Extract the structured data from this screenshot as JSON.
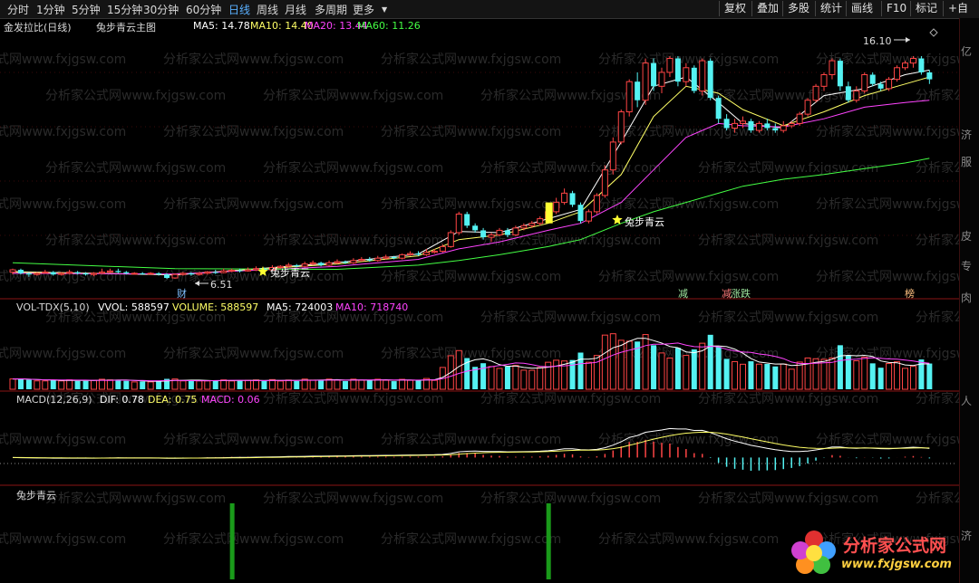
{
  "toolbar": {
    "tabs": [
      {
        "label": "分时",
        "active": false
      },
      {
        "label": "1分钟",
        "active": false
      },
      {
        "label": "5分钟",
        "active": false
      },
      {
        "label": "15分钟",
        "active": false
      },
      {
        "label": "30分钟",
        "active": false
      },
      {
        "label": "60分钟",
        "active": false
      },
      {
        "label": "日线",
        "active": true
      },
      {
        "label": "周线",
        "active": false
      },
      {
        "label": "月线",
        "active": false
      },
      {
        "label": "多周期",
        "active": false
      },
      {
        "label": "更多",
        "active": false
      }
    ],
    "more_arrow": "▼",
    "right_buttons": [
      "复权",
      "叠加",
      "多股",
      "统计",
      "画线",
      "F10",
      "标记",
      "+自"
    ]
  },
  "main_panel": {
    "title": "金发拉比(日线)",
    "indicator_name": "兔步青云主图",
    "ma5": "MA5: 14.78",
    "ma10": "MA10: 14.40",
    "ma20": "MA20: 13.44",
    "ma60": "MA60: 11.26",
    "high_label": "16.10",
    "low_label": "6.51",
    "signals": [
      "兔步青云",
      "兔步青云"
    ],
    "markers": [
      "财",
      "减",
      "减",
      "涨跌",
      "榜"
    ]
  },
  "vol_panel": {
    "title": "VOL-TDX(5,10)",
    "vvol": "VVOL: 588597",
    "volume": "VOLUME: 588597",
    "ma5": "MA5: 724003",
    "ma10": "MA10: 718740"
  },
  "macd_panel": {
    "title": "MACD(12,26,9)",
    "dif": "DIF: 0.78",
    "dea": "DEA: 0.75",
    "macd": "MACD: 0.06"
  },
  "signal_panel": {
    "title": "兔步青云"
  },
  "watermarks": {
    "brand": "分析家公式网",
    "url": "www.fxjgsw.com",
    "bg_text": "分析家公式网www.fxjgsw.com"
  },
  "side_labels": [
    "亿",
    "济",
    "服",
    "皮",
    "专",
    "肉",
    "人",
    "济"
  ],
  "colors": {
    "up": "#ff4545",
    "down": "#54f2f2",
    "ma5": "#ffffff",
    "ma10": "#ffff66",
    "ma20": "#ff44ff",
    "ma60": "#44ff44",
    "grid_line": "#8a1414",
    "accent": "#5ab0ff"
  },
  "chart_data": {
    "type": "candlestick",
    "candles": [
      [
        6.8,
        6.9,
        6.95,
        6.7
      ],
      [
        6.9,
        6.75,
        6.95,
        6.7
      ],
      [
        6.75,
        6.7,
        6.8,
        6.6
      ],
      [
        6.7,
        6.75,
        6.8,
        6.65
      ],
      [
        6.8,
        6.8,
        6.9,
        6.75
      ],
      [
        6.8,
        6.7,
        6.85,
        6.65
      ],
      [
        6.7,
        6.75,
        6.8,
        6.65
      ],
      [
        6.75,
        6.8,
        6.9,
        6.7
      ],
      [
        6.8,
        6.75,
        6.85,
        6.7
      ],
      [
        6.75,
        6.7,
        6.8,
        6.65
      ],
      [
        6.7,
        6.75,
        6.8,
        6.62
      ],
      [
        6.75,
        6.8,
        6.95,
        6.72
      ],
      [
        6.8,
        6.85,
        6.95,
        6.75
      ],
      [
        6.85,
        6.8,
        6.95,
        6.75
      ],
      [
        6.8,
        6.75,
        6.85,
        6.7
      ],
      [
        6.75,
        6.75,
        6.8,
        6.7
      ],
      [
        6.75,
        6.72,
        6.8,
        6.68
      ],
      [
        6.72,
        6.75,
        6.8,
        6.7
      ],
      [
        6.75,
        6.7,
        6.8,
        6.65
      ],
      [
        6.7,
        6.55,
        6.75,
        6.51
      ],
      [
        6.55,
        6.7,
        6.75,
        6.51
      ],
      [
        6.7,
        6.75,
        6.8,
        6.65
      ],
      [
        6.75,
        6.7,
        6.8,
        6.65
      ],
      [
        6.7,
        6.75,
        6.8,
        6.65
      ],
      [
        6.75,
        6.8,
        6.85,
        6.7
      ],
      [
        6.8,
        6.78,
        6.9,
        6.72
      ],
      [
        6.78,
        6.85,
        6.95,
        6.75
      ],
      [
        6.85,
        6.88,
        6.95,
        6.8
      ],
      [
        6.88,
        6.85,
        6.95,
        6.78
      ],
      [
        6.85,
        6.9,
        7.0,
        6.82
      ],
      [
        6.9,
        6.95,
        7.05,
        6.85
      ],
      [
        6.95,
        6.9,
        7.0,
        6.85
      ],
      [
        6.9,
        7.0,
        7.1,
        6.88
      ],
      [
        7.0,
        7.05,
        7.1,
        6.95
      ],
      [
        7.05,
        7.1,
        7.2,
        7.0
      ],
      [
        7.1,
        7.05,
        7.15,
        7.0
      ],
      [
        7.05,
        7.15,
        7.25,
        7.0
      ],
      [
        7.15,
        7.2,
        7.3,
        7.1
      ],
      [
        7.2,
        7.1,
        7.25,
        7.05
      ],
      [
        7.1,
        7.2,
        7.3,
        7.05
      ],
      [
        7.2,
        7.25,
        7.35,
        7.15
      ],
      [
        7.25,
        7.2,
        7.3,
        7.15
      ],
      [
        7.2,
        7.3,
        7.4,
        7.15
      ],
      [
        7.3,
        7.35,
        7.45,
        7.25
      ],
      [
        7.35,
        7.3,
        7.45,
        7.25
      ],
      [
        7.3,
        7.4,
        7.5,
        7.25
      ],
      [
        7.4,
        7.45,
        7.55,
        7.35
      ],
      [
        7.45,
        7.4,
        7.5,
        7.35
      ],
      [
        7.4,
        7.55,
        7.6,
        7.35
      ],
      [
        7.55,
        7.6,
        7.7,
        7.5
      ],
      [
        7.6,
        7.55,
        7.7,
        7.5
      ],
      [
        7.55,
        7.65,
        7.8,
        7.5
      ],
      [
        7.65,
        7.7,
        7.8,
        7.6
      ],
      [
        7.7,
        7.9,
        8.0,
        7.65
      ],
      [
        7.9,
        8.5,
        8.6,
        7.85
      ],
      [
        8.5,
        9.3,
        9.4,
        8.4
      ],
      [
        9.3,
        8.8,
        9.4,
        8.7
      ],
      [
        8.8,
        8.6,
        8.9,
        8.5
      ],
      [
        8.6,
        8.3,
        8.7,
        8.2
      ],
      [
        8.3,
        8.4,
        8.5,
        8.1
      ],
      [
        8.4,
        8.6,
        8.7,
        8.35
      ],
      [
        8.6,
        8.4,
        8.7,
        8.3
      ],
      [
        8.4,
        8.7,
        8.8,
        8.35
      ],
      [
        8.7,
        8.8,
        8.9,
        8.6
      ],
      [
        8.8,
        8.9,
        9.0,
        8.7
      ],
      [
        8.9,
        9.1,
        9.2,
        8.8
      ],
      [
        9.1,
        9.4,
        9.6,
        9.0
      ],
      [
        9.4,
        9.8,
        10.0,
        9.3
      ],
      [
        9.8,
        10.2,
        10.4,
        9.7
      ],
      [
        10.2,
        9.7,
        10.3,
        9.6
      ],
      [
        9.7,
        9.0,
        9.8,
        8.9
      ],
      [
        9.0,
        9.4,
        9.5,
        8.9
      ],
      [
        9.4,
        10.1,
        10.2,
        9.3
      ],
      [
        10.1,
        11.2,
        11.4,
        10.0
      ],
      [
        11.2,
        12.4,
        12.6,
        11.0
      ],
      [
        12.4,
        13.7,
        13.8,
        12.3
      ],
      [
        13.7,
        15.0,
        15.1,
        13.5
      ],
      [
        15.0,
        14.2,
        15.4,
        13.9
      ],
      [
        14.2,
        15.8,
        16.0,
        14.0
      ],
      [
        15.8,
        14.8,
        16.0,
        14.6
      ],
      [
        14.8,
        15.4,
        15.6,
        14.5
      ],
      [
        15.4,
        16.0,
        16.1,
        15.2
      ],
      [
        16.0,
        15.0,
        16.1,
        14.8
      ],
      [
        15.0,
        15.6,
        15.8,
        14.8
      ],
      [
        15.6,
        14.6,
        15.7,
        14.5
      ],
      [
        14.6,
        15.9,
        16.0,
        14.4
      ],
      [
        15.9,
        14.3,
        16.0,
        14.2
      ],
      [
        14.3,
        13.4,
        14.4,
        13.2
      ],
      [
        13.4,
        13.0,
        13.6,
        12.9
      ],
      [
        13.0,
        13.2,
        13.4,
        12.8
      ],
      [
        13.2,
        13.3,
        13.5,
        13.0
      ],
      [
        13.3,
        12.9,
        13.4,
        12.8
      ],
      [
        12.9,
        13.2,
        13.3,
        12.8
      ],
      [
        13.2,
        13.0,
        13.4,
        12.9
      ],
      [
        13.0,
        12.9,
        13.2,
        12.8
      ],
      [
        12.9,
        13.1,
        13.3,
        12.8
      ],
      [
        13.1,
        13.2,
        13.3,
        13.0
      ],
      [
        13.2,
        13.6,
        13.7,
        13.1
      ],
      [
        13.6,
        14.2,
        14.3,
        13.5
      ],
      [
        14.2,
        14.8,
        14.9,
        14.1
      ],
      [
        14.8,
        15.3,
        15.4,
        14.6
      ],
      [
        15.3,
        15.9,
        16.0,
        15.1
      ],
      [
        15.9,
        14.8,
        16.0,
        14.6
      ],
      [
        14.8,
        14.2,
        15.0,
        14.1
      ],
      [
        14.2,
        14.6,
        14.8,
        14.1
      ],
      [
        14.6,
        15.3,
        15.4,
        14.5
      ],
      [
        15.3,
        14.9,
        15.4,
        14.8
      ],
      [
        14.9,
        14.7,
        15.0,
        14.6
      ],
      [
        14.7,
        15.1,
        15.2,
        14.6
      ],
      [
        15.1,
        15.6,
        15.7,
        15.0
      ],
      [
        15.6,
        15.8,
        15.9,
        15.5
      ],
      [
        15.8,
        16.0,
        16.1,
        15.6
      ],
      [
        16.0,
        15.4,
        16.1,
        15.3
      ],
      [
        15.4,
        15.1,
        15.5,
        14.9
      ]
    ],
    "price_range": [
      6.2,
      16.8
    ],
    "ma_series": [
      {
        "name": "MA5",
        "pts": [
          [
            0,
            6.82
          ],
          [
            20,
            6.68
          ],
          [
            40,
            7.21
          ],
          [
            50,
            7.58
          ],
          [
            55,
            8.55
          ],
          [
            60,
            8.5
          ],
          [
            66,
            9.1
          ],
          [
            70,
            9.5
          ],
          [
            75,
            12.4
          ],
          [
            79,
            14.8
          ],
          [
            83,
            15.2
          ],
          [
            87,
            14.1
          ],
          [
            90,
            13.2
          ],
          [
            95,
            13.0
          ],
          [
            100,
            14.4
          ],
          [
            105,
            14.7
          ],
          [
            110,
            15.3
          ],
          [
            113,
            15.5
          ]
        ]
      },
      {
        "name": "MA10",
        "pts": [
          [
            0,
            6.8
          ],
          [
            20,
            6.7
          ],
          [
            40,
            7.15
          ],
          [
            50,
            7.5
          ],
          [
            55,
            8.2
          ],
          [
            60,
            8.4
          ],
          [
            66,
            8.9
          ],
          [
            70,
            9.4
          ],
          [
            75,
            11.0
          ],
          [
            79,
            13.5
          ],
          [
            83,
            14.8
          ],
          [
            87,
            14.5
          ],
          [
            90,
            13.8
          ],
          [
            95,
            13.1
          ],
          [
            100,
            13.7
          ],
          [
            105,
            14.4
          ],
          [
            110,
            14.9
          ],
          [
            113,
            15.2
          ]
        ]
      },
      {
        "name": "MA20",
        "pts": [
          [
            0,
            6.75
          ],
          [
            20,
            6.72
          ],
          [
            40,
            7.05
          ],
          [
            50,
            7.35
          ],
          [
            55,
            7.8
          ],
          [
            60,
            8.1
          ],
          [
            66,
            8.6
          ],
          [
            70,
            8.9
          ],
          [
            75,
            9.8
          ],
          [
            79,
            11.2
          ],
          [
            83,
            12.6
          ],
          [
            87,
            13.2
          ],
          [
            90,
            13.1
          ],
          [
            95,
            13.05
          ],
          [
            100,
            13.4
          ],
          [
            105,
            13.9
          ],
          [
            110,
            14.1
          ],
          [
            113,
            14.2
          ]
        ]
      },
      {
        "name": "MA60",
        "pts": [
          [
            0,
            7.2
          ],
          [
            20,
            6.95
          ],
          [
            40,
            6.92
          ],
          [
            50,
            7.1
          ],
          [
            55,
            7.3
          ],
          [
            60,
            7.55
          ],
          [
            66,
            7.9
          ],
          [
            70,
            8.2
          ],
          [
            75,
            8.9
          ],
          [
            79,
            9.4
          ],
          [
            83,
            9.8
          ],
          [
            87,
            10.2
          ],
          [
            90,
            10.5
          ],
          [
            95,
            10.8
          ],
          [
            100,
            11.0
          ],
          [
            105,
            11.26
          ],
          [
            110,
            11.5
          ],
          [
            113,
            11.7
          ]
        ]
      }
    ],
    "volume_range": [
      0,
      1300000
    ],
    "macd_range": [
      -0.6,
      1.4
    ],
    "signal_bars_at": [
      28,
      67
    ]
  }
}
